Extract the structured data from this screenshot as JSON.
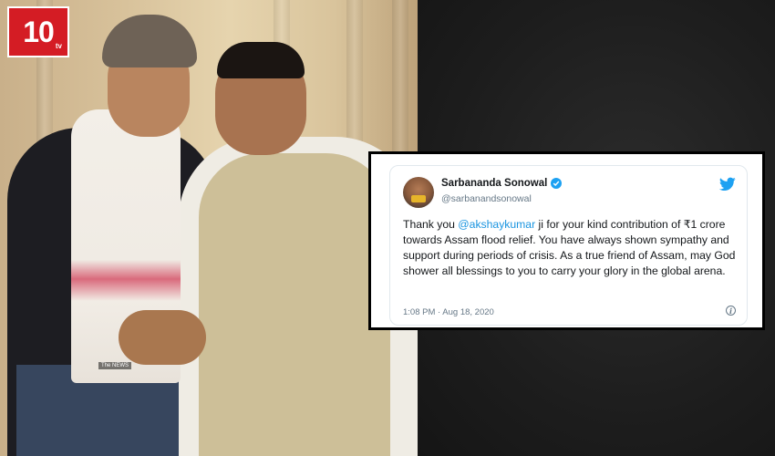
{
  "logo": {
    "text": "10",
    "sub": "tv"
  },
  "photo": {
    "watermark": "The NEWS"
  },
  "tweet": {
    "author_name": "Sarbananda Sonowal",
    "author_handle": "@sarbanandsonowal",
    "text_before_mention": "Thank you ",
    "mention": "@akshaykumar",
    "text_after_mention": " ji for your kind contribution of ₹1 crore towards Assam flood relief. You have always shown sympathy and support during periods of crisis. As a true friend of Assam, may God shower all blessings to you to carry your glory in the global arena.",
    "timestamp": "1:08 PM · Aug 18, 2020",
    "icons": {
      "verified": "verified-badge-icon",
      "platform": "twitter-bird-icon",
      "info": "info-icon"
    }
  },
  "colors": {
    "logo_red": "#d41c24",
    "mention_blue": "#1b95e0",
    "verified_blue": "#1da1f2",
    "muted_text": "#657786"
  }
}
